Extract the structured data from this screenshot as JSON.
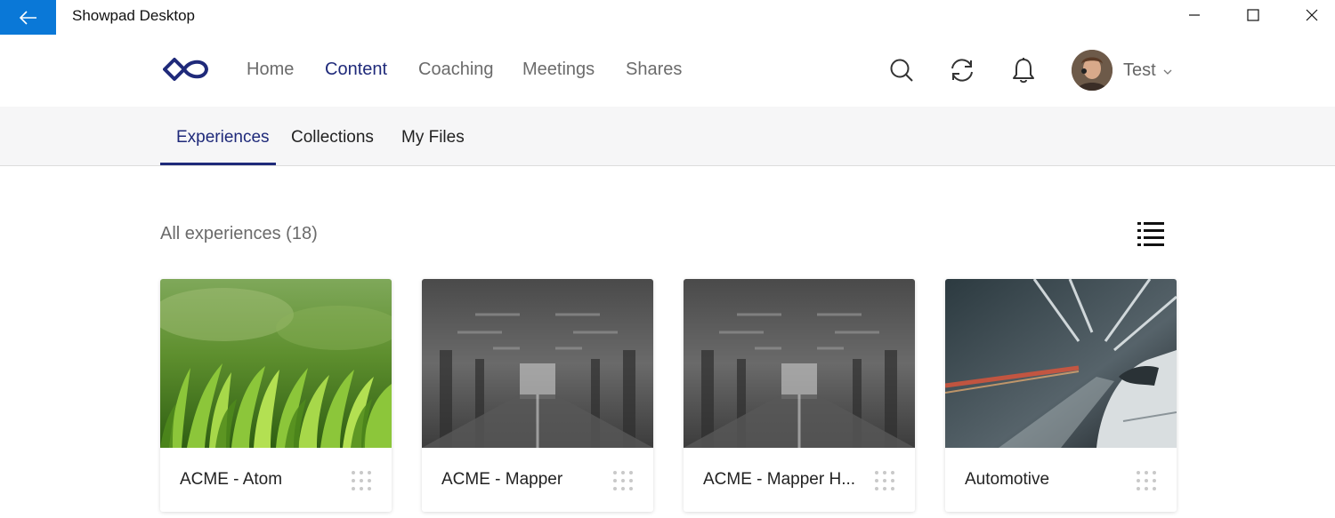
{
  "window": {
    "title": "Showpad Desktop",
    "accent_color": "#0a78d7"
  },
  "nav": {
    "items": [
      {
        "label": "Home",
        "active": false
      },
      {
        "label": "Content",
        "active": true
      },
      {
        "label": "Coaching",
        "active": false
      },
      {
        "label": "Meetings",
        "active": false
      },
      {
        "label": "Shares",
        "active": false
      }
    ],
    "icons": [
      "search-icon",
      "sync-icon",
      "bell-icon"
    ],
    "user": {
      "name": "Test"
    },
    "brand_color": "#1f2a7a"
  },
  "subtabs": {
    "items": [
      {
        "label": "Experiences",
        "active": true
      },
      {
        "label": "Collections",
        "active": false
      },
      {
        "label": "My Files",
        "active": false
      }
    ]
  },
  "content": {
    "section_title": "All experiences (18)",
    "cards": [
      {
        "label": "ACME - Atom",
        "thumb": "grass"
      },
      {
        "label": "ACME - Mapper",
        "thumb": "hall"
      },
      {
        "label": "ACME - Mapper H...",
        "thumb": "hall"
      },
      {
        "label": "Automotive",
        "thumb": "car"
      }
    ]
  }
}
